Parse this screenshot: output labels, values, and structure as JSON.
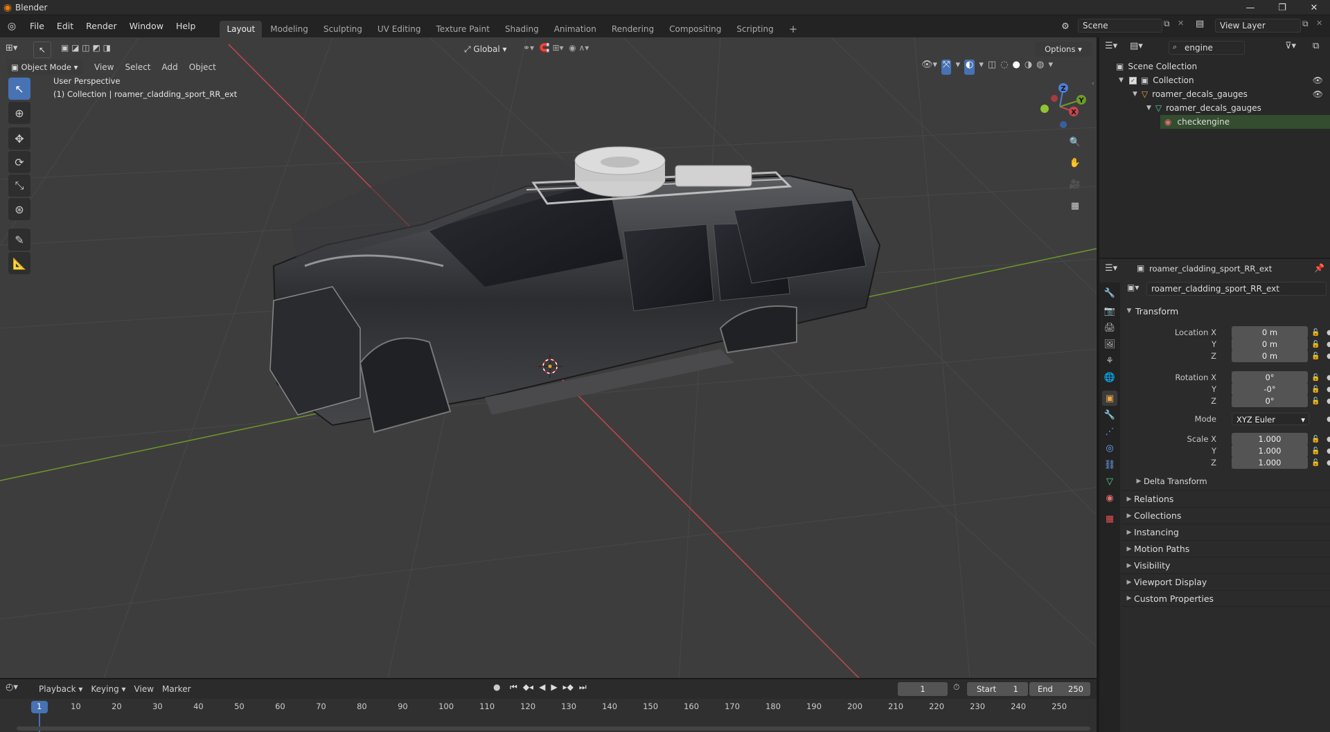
{
  "window": {
    "title": "Blender",
    "minimize": "—",
    "maximize": "❐",
    "close": "✕"
  },
  "menu": [
    "File",
    "Edit",
    "Render",
    "Window",
    "Help"
  ],
  "workspaces": [
    "Layout",
    "Modeling",
    "Sculpting",
    "UV Editing",
    "Texture Paint",
    "Shading",
    "Animation",
    "Rendering",
    "Compositing",
    "Scripting"
  ],
  "active_workspace": "Layout",
  "add_workspace": "+",
  "scene": {
    "label": "Scene"
  },
  "view_layer": {
    "label": "View Layer"
  },
  "viewport": {
    "mode": "Object Mode",
    "menus": [
      "View",
      "Select",
      "Add",
      "Object"
    ],
    "orientation": "Global",
    "options": "Options",
    "perspective": "User Perspective",
    "collection_info": "(1) Collection | roamer_cladding_sport_RR_ext"
  },
  "gizmo": {
    "x": "X",
    "y": "Y",
    "z": "Z"
  },
  "outliner": {
    "search_value": "engine",
    "rows": [
      {
        "label": "Scene Collection",
        "icon": "scene-collection-icon"
      },
      {
        "label": "Collection",
        "icon": "collection-icon"
      },
      {
        "label": "roamer_decals_gauges",
        "icon": "object-icon"
      },
      {
        "label": "roamer_decals_gauges",
        "icon": "mesh-data-icon"
      },
      {
        "label": "checkengine",
        "icon": "material-icon"
      }
    ]
  },
  "properties": {
    "object_name": "roamer_cladding_sport_RR_ext",
    "datablock": "roamer_cladding_sport_RR_ext",
    "transform": {
      "title": "Transform",
      "location": {
        "label": "Location X",
        "x": "0 m",
        "y": "0 m",
        "z": "0 m"
      },
      "rotation": {
        "label": "Rotation X",
        "x": "0°",
        "y": "-0°",
        "z": "0°"
      },
      "mode": {
        "label": "Mode",
        "value": "XYZ Euler"
      },
      "scale": {
        "label": "Scale X",
        "x": "1.000",
        "y": "1.000",
        "z": "1.000"
      },
      "y_label": "Y",
      "z_label": "Z",
      "delta": "Delta Transform"
    },
    "panels": [
      "Relations",
      "Collections",
      "Instancing",
      "Motion Paths",
      "Visibility",
      "Viewport Display",
      "Custom Properties"
    ]
  },
  "timeline": {
    "menus": [
      "Playback",
      "Keying",
      "View",
      "Marker"
    ],
    "current_frame": "1",
    "start_label": "Start",
    "start": "1",
    "end_label": "End",
    "end": "250",
    "ruler": [
      "1",
      "10",
      "20",
      "30",
      "40",
      "50",
      "60",
      "70",
      "80",
      "90",
      "100",
      "110",
      "120",
      "130",
      "140",
      "150",
      "160",
      "170",
      "180",
      "190",
      "200",
      "210",
      "220",
      "230",
      "240",
      "250"
    ]
  },
  "colors": {
    "accent": "#4772b3",
    "x_axis": "#c4484d",
    "y_axis": "#6d9a2b",
    "z_axis": "#4d7fd6",
    "blender_orange": "#e87d0d"
  }
}
